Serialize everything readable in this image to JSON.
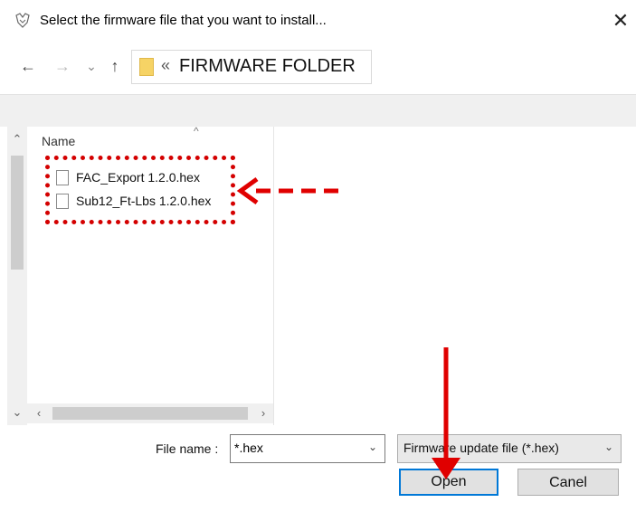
{
  "window": {
    "title": "Select the firmware file that you want to install...",
    "close_glyph": "✕"
  },
  "nav": {
    "back_glyph": "←",
    "forward_glyph": "→",
    "recent_glyph": "⌄",
    "up_glyph": "↑",
    "breadcrumb_separator": "«",
    "current_folder": "FIRMWARE FOLDER"
  },
  "file_list": {
    "column_header": "Name",
    "sort_indicator": "^",
    "files": [
      {
        "name": "FAC_Export 1.2.0.hex",
        "icon": "document-icon"
      },
      {
        "name": "Sub12_Ft-Lbs 1.2.0.hex",
        "icon": "document-icon"
      }
    ]
  },
  "footer": {
    "file_name_label": "File name :",
    "file_name_value": "*.hex",
    "file_type_value": "Firmware update file (*.hex)",
    "open_label": "Open",
    "cancel_label": "Canel"
  },
  "annotations": {
    "highlight_color": "#d40000",
    "arrow_color": "#e00000"
  },
  "colors": {
    "accent": "#0078d7",
    "toolbar_bg": "#f0f0f0",
    "button_bg": "#e1e1e1"
  }
}
